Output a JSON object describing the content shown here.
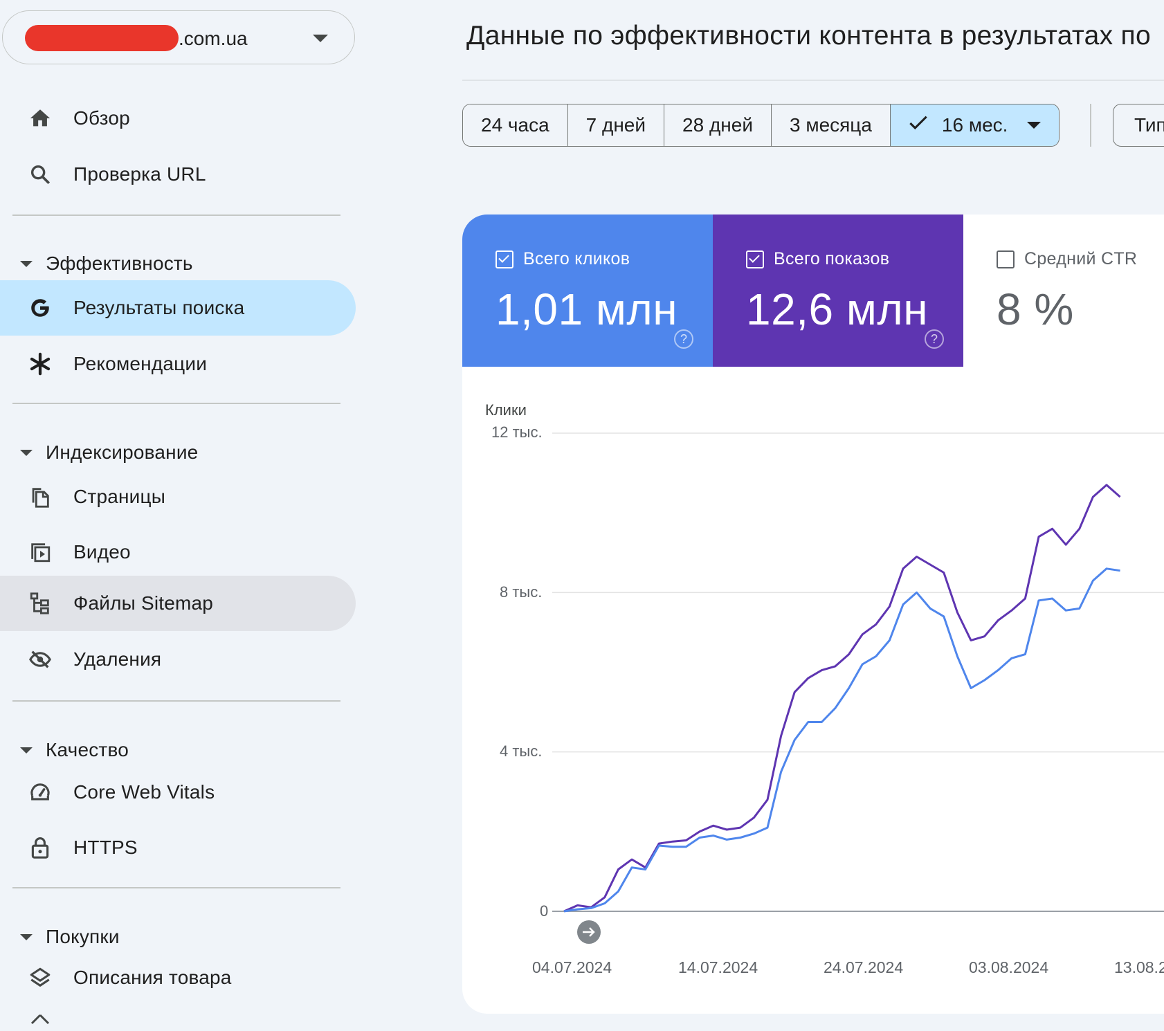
{
  "property": {
    "domain_suffix": ".com.ua"
  },
  "sidebar": {
    "top_items": [
      {
        "label": "Обзор",
        "icon": "home-icon"
      },
      {
        "label": "Проверка URL",
        "icon": "search-icon"
      }
    ],
    "sections": [
      {
        "title": "Эффективность",
        "items": [
          {
            "label": "Результаты поиска",
            "icon": "google-g-icon",
            "state": "active"
          },
          {
            "label": "Рекомендации",
            "icon": "asterisk-icon"
          }
        ]
      },
      {
        "title": "Индексирование",
        "items": [
          {
            "label": "Страницы",
            "icon": "pages-icon"
          },
          {
            "label": "Видео",
            "icon": "video-icon"
          },
          {
            "label": "Файлы Sitemap",
            "icon": "sitemap-icon",
            "state": "hover"
          },
          {
            "label": "Удаления",
            "icon": "eye-off-icon"
          }
        ]
      },
      {
        "title": "Качество",
        "items": [
          {
            "label": "Core Web Vitals",
            "icon": "gauge-icon"
          },
          {
            "label": "HTTPS",
            "icon": "lock-icon"
          }
        ]
      },
      {
        "title": "Покупки",
        "items": [
          {
            "label": "Описания товара",
            "icon": "layers-icon"
          }
        ]
      }
    ]
  },
  "main": {
    "title": "Данные по эффективности контента в результатах по",
    "date_ranges": [
      "24 часа",
      "7 дней",
      "28 дней",
      "3 месяца",
      "16 мес."
    ],
    "selected_range": "16 мес.",
    "type_filter_label": "Тип",
    "metrics": {
      "clicks": {
        "label": "Всего кликов",
        "value": "1,01 млн",
        "checked": true,
        "color": "#4f86ec"
      },
      "impressions": {
        "label": "Всего показов",
        "value": "12,6 млн",
        "checked": true,
        "color": "#5e35b1"
      },
      "ctr": {
        "label": "Средний CTR",
        "value": "8 %",
        "checked": false
      }
    }
  },
  "chart_data": {
    "type": "line",
    "ylabel": "Клики",
    "yticks": [
      "12 тыс.",
      "8 тыс.",
      "4 тыс.",
      "0"
    ],
    "ylim": [
      0,
      12000
    ],
    "xticks": [
      "04.07.2024",
      "14.07.2024",
      "24.07.2024",
      "03.08.2024",
      "13.08.2"
    ],
    "series": [
      {
        "color": "#4f86ec",
        "values": [
          0,
          50,
          80,
          200,
          500,
          1100,
          1050,
          1650,
          1620,
          1620,
          1850,
          1900,
          1800,
          1850,
          1950,
          2100,
          3500,
          4300,
          4750,
          4750,
          5100,
          5600,
          6200,
          6400,
          6800,
          7700,
          8000,
          7600,
          7400,
          6400,
          5600,
          5800,
          6050,
          6350,
          6450,
          7800,
          7850,
          7550,
          7600,
          8300,
          8600,
          8550
        ]
      },
      {
        "color": "#5e35b1",
        "values": [
          0,
          150,
          100,
          350,
          1050,
          1300,
          1100,
          1700,
          1750,
          1780,
          2000,
          2150,
          2050,
          2100,
          2350,
          2800,
          4400,
          5500,
          5850,
          6050,
          6150,
          6450,
          6950,
          7200,
          7650,
          8600,
          8900,
          8700,
          8500,
          7500,
          6800,
          6900,
          7300,
          7550,
          7850,
          9400,
          9600,
          9200,
          9600,
          10400,
          10700,
          10400
        ]
      }
    ]
  }
}
